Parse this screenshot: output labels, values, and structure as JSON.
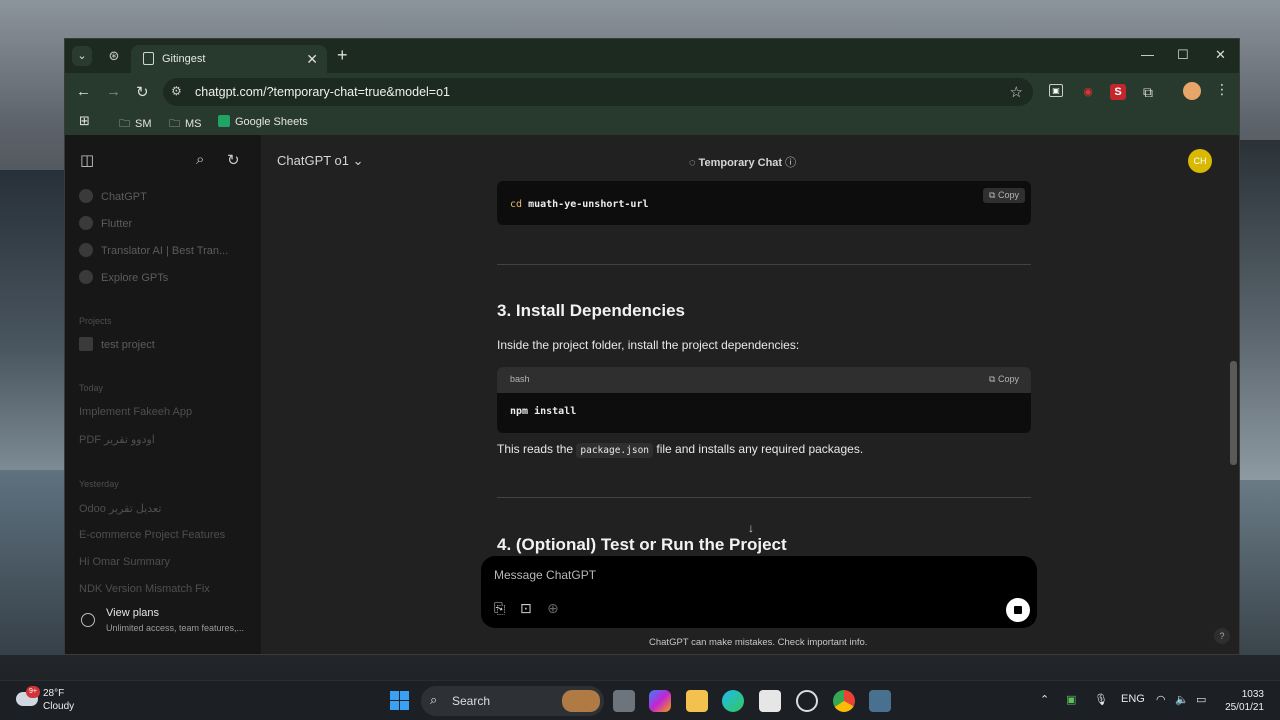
{
  "browser": {
    "tab_title": "Gitingest",
    "url": "chatgpt.com/?temporary-chat=true&model=o1",
    "bookmarks": [
      "SM",
      "MS",
      "Google Sheets"
    ]
  },
  "sidebar": {
    "items": [
      "ChatGPT",
      "Flutter",
      "Translator AI | Best Tran...",
      "Explore GPTs"
    ],
    "projects_header": "Projects",
    "projects": [
      "test project"
    ],
    "sections": [
      {
        "title": "Today",
        "chats": [
          "Implement Fakeeh App",
          "PDF اودوو تقرير"
        ]
      },
      {
        "title": "Yesterday",
        "chats": [
          "Odoo تعديل تقرير",
          "E-commerce Project Features",
          "Hi Omar Summary",
          "NDK Version Mismatch Fix"
        ]
      }
    ],
    "plans": {
      "title": "View plans",
      "subtitle": "Unlimited access, team features,..."
    }
  },
  "header": {
    "model": "ChatGPT o1",
    "temporary_chat": "Temporary Chat",
    "avatar_initials": "CH"
  },
  "content": {
    "code1": {
      "copy": "Copy",
      "prefix": "cd",
      "text": "muath-ye-unshort-url"
    },
    "section3_title": "3. Install Dependencies",
    "section3_intro": "Inside the project folder, install the project dependencies:",
    "code2": {
      "lang": "bash",
      "copy": "Copy",
      "text": "npm install"
    },
    "reads_pre": "This reads the",
    "reads_code": "package.json",
    "reads_post": "file and installs any required packages.",
    "section4_title": "4. (Optional) Test or Run the Project"
  },
  "composer": {
    "placeholder": "Message ChatGPT",
    "disclaimer": "ChatGPT can make mistakes. Check important info.",
    "help": "?"
  },
  "taskbar": {
    "weather_badge": "9+",
    "temperature": "28°F",
    "condition": "Cloudy",
    "search": "Search",
    "lang": "ENG",
    "time": "1033",
    "date": "25/01/21"
  }
}
